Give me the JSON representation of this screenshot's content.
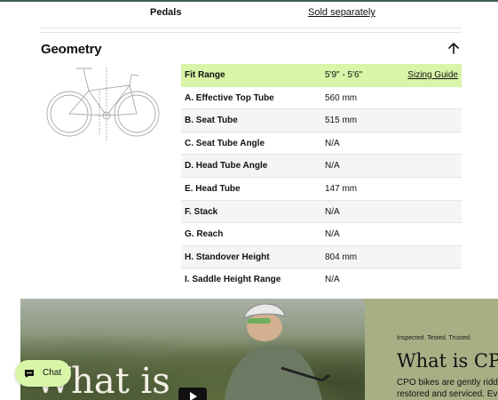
{
  "pedals": {
    "label": "Pedals",
    "value": "Sold separately"
  },
  "geometry": {
    "title": "Geometry",
    "fit_range": {
      "label": "Fit Range",
      "value": "5'9\" - 5'6\"",
      "link": "Sizing Guide"
    },
    "rows": [
      {
        "label": "A. Effective Top Tube",
        "value": "560 mm"
      },
      {
        "label": "B. Seat Tube",
        "value": "515 mm"
      },
      {
        "label": "C. Seat Tube Angle",
        "value": "N/A"
      },
      {
        "label": "D. Head Tube Angle",
        "value": "N/A"
      },
      {
        "label": "E. Head Tube",
        "value": "147 mm"
      },
      {
        "label": "F. Stack",
        "value": "N/A"
      },
      {
        "label": "G. Reach",
        "value": "N/A"
      },
      {
        "label": "H. Standover Height",
        "value": "804 mm"
      },
      {
        "label": "I. Saddle Height Range",
        "value": "N/A"
      }
    ]
  },
  "hero": {
    "photo_text": "What is",
    "eyebrow": "Inspected. Tested. Trusted.",
    "heading": "What is CPO?",
    "body_line1": "CPO bikes are gently ridden,",
    "body_line2": "restored and serviced. Every"
  },
  "chat": {
    "label": "Chat"
  },
  "colors": {
    "accent": "#d8f5a8",
    "panel": "#a9af85",
    "top_rule": "#3f5f55"
  }
}
